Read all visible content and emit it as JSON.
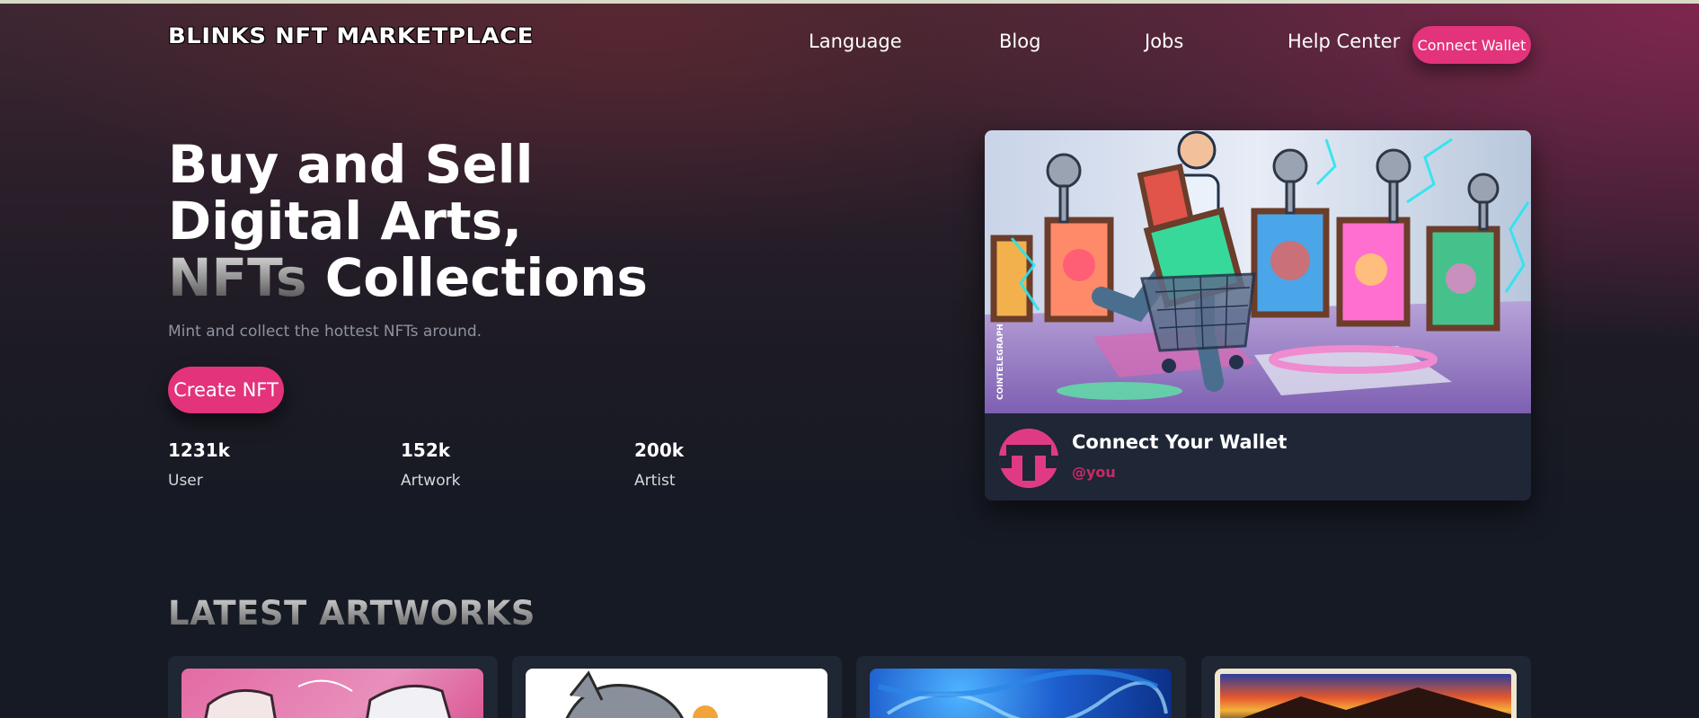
{
  "header": {
    "logo_text": "BLINKS NFT MARKETPLACE",
    "nav": [
      "Language",
      "Blog",
      "Jobs",
      "Help Center"
    ],
    "connect_wallet_label": "Connect Wallet"
  },
  "hero": {
    "headline_line1": "Buy and Sell",
    "headline_line2": "Digital Arts,",
    "headline_line3_faded": "NFTs",
    "headline_line3_rest": " Collections",
    "subtitle": "Mint and collect the hottest NFTs around.",
    "create_button_label": "Create NFT",
    "stats": [
      {
        "value": "1231k",
        "label": "User"
      },
      {
        "value": "152k",
        "label": "Artwork"
      },
      {
        "value": "200k",
        "label": "Artist"
      }
    ]
  },
  "featured_card": {
    "image_icon": "nft-shopping-illustration",
    "watermark": "COINTELEGRAPH",
    "title": "Connect Your Wallet",
    "handle": "@you",
    "avatar_icon": "t-logo-icon"
  },
  "latest": {
    "title": "LATEST ARTWORKS",
    "artworks": [
      {
        "thumb": "sneakers-art"
      },
      {
        "thumb": "cartoon-cat-art"
      },
      {
        "thumb": "blue-abstract-art"
      },
      {
        "thumb": "sunset-painting-art"
      }
    ]
  },
  "colors": {
    "accent": "#e3337a",
    "card_bg": "#1f2635",
    "handle": "#c92a67"
  }
}
